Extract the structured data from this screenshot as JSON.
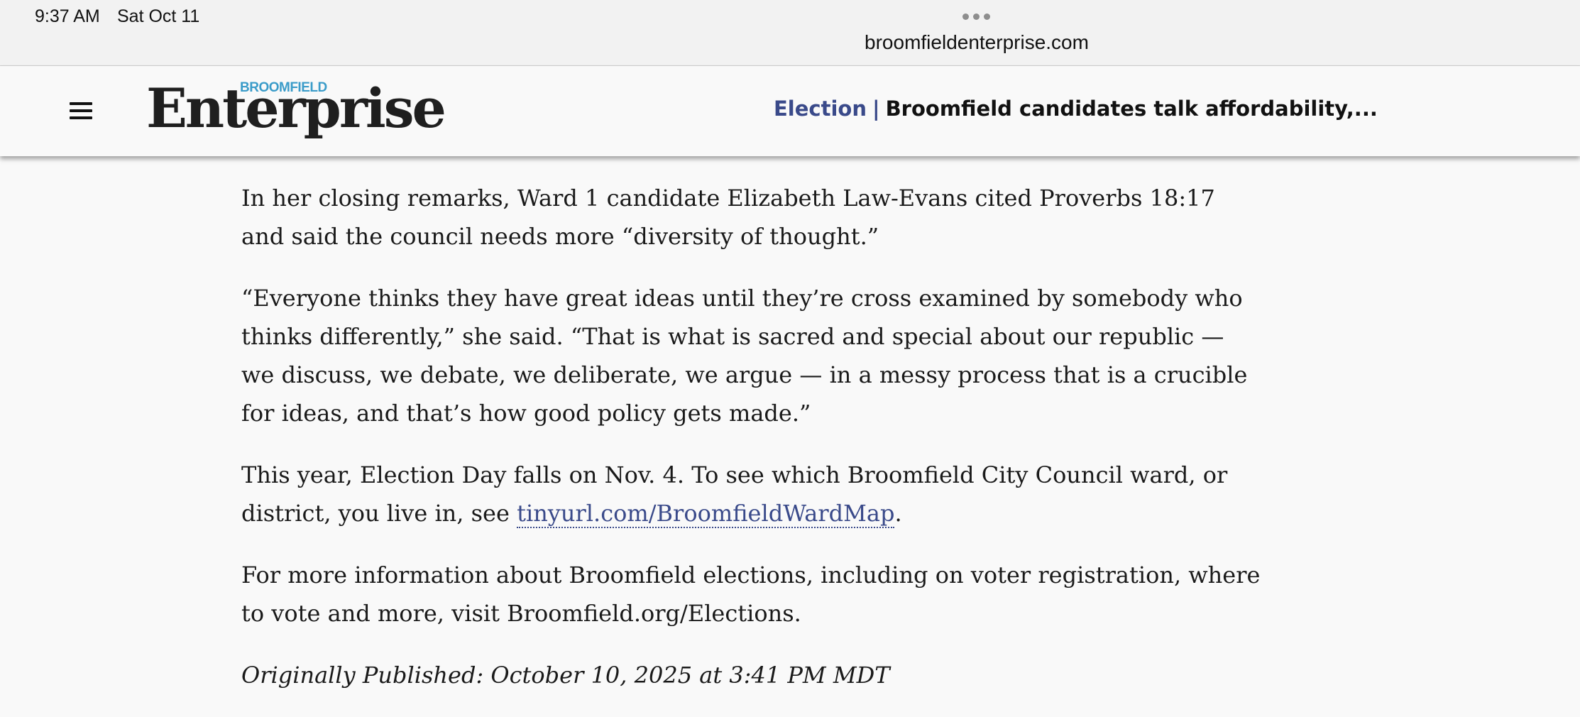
{
  "status_bar": {
    "time": "9:37 AM",
    "date": "Sat Oct 11"
  },
  "browser": {
    "url": "broomfieldenterprise.com"
  },
  "site": {
    "logo_kicker": "BROOMFIELD",
    "logo_word": "Enterprise",
    "section": "Election",
    "separator": "|",
    "headline": "Broomfield candidates talk affordability,..."
  },
  "article": {
    "p1": "In her closing remarks, Ward 1 candidate Elizabeth Law-Evans cited Proverbs 18:17 and said the council needs more “diversity of thought.”",
    "p2": "“Everyone thinks they have great ideas until they’re cross examined by somebody who thinks differently,” she said. “That is what is sacred and special about our republic — we discuss, we debate, we deliberate, we argue — in a messy process that is a crucible for ideas, and that’s how good policy gets made.”",
    "p3_before": "This year, Election Day falls on Nov. 4. To see which Broomfield City Council ward, or district, you live in, see ",
    "p3_link": "tinyurl.com/BroomfieldWardMap",
    "p3_after": ".",
    "p4": "For more information about Broomfield elections, including on voter registration, where to vote and more, visit Broomfield.org/Elections.",
    "published": "Originally Published: October 10, 2025 at 3:41 PM MDT"
  },
  "colors": {
    "link": "#3a4a8a",
    "logo_kicker": "#3b9cc9",
    "background": "#f9f9f9"
  },
  "icons": {
    "menu": "hamburger-menu-icon",
    "multitask": "multitasking-dots-icon"
  }
}
